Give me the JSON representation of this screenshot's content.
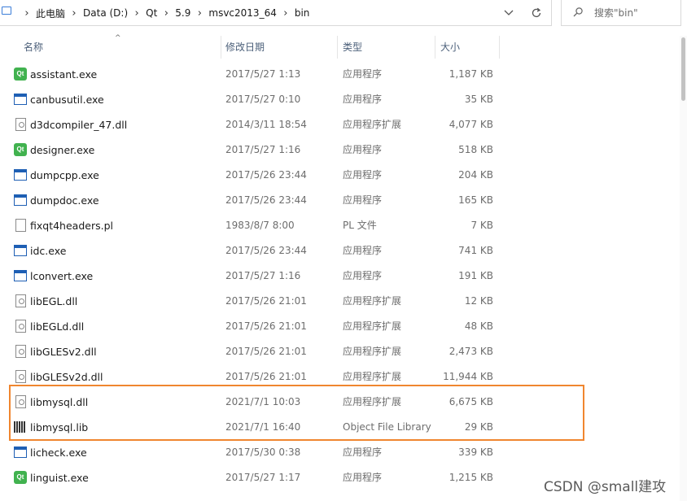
{
  "address_bar": {
    "crumbs": [
      "此电脑",
      "Data (D:)",
      "Qt",
      "5.9",
      "msvc2013_64",
      "bin"
    ],
    "separator": "›"
  },
  "search": {
    "placeholder": "搜索\"bin\""
  },
  "columns": {
    "name": "名称",
    "date": "修改日期",
    "type": "类型",
    "size": "大小"
  },
  "files": [
    {
      "name": "assistant.exe",
      "date": "2017/5/27 1:13",
      "type": "应用程序",
      "size": "1,187 KB",
      "icon": "qt-app-icon"
    },
    {
      "name": "canbusutil.exe",
      "date": "2017/5/27 0:10",
      "type": "应用程序",
      "size": "35 KB",
      "icon": "exe-icon"
    },
    {
      "name": "d3dcompiler_47.dll",
      "date": "2014/3/11 18:54",
      "type": "应用程序扩展",
      "size": "4,077 KB",
      "icon": "dll-icon"
    },
    {
      "name": "designer.exe",
      "date": "2017/5/27 1:16",
      "type": "应用程序",
      "size": "518 KB",
      "icon": "qt-app-icon"
    },
    {
      "name": "dumpcpp.exe",
      "date": "2017/5/26 23:44",
      "type": "应用程序",
      "size": "204 KB",
      "icon": "exe-icon"
    },
    {
      "name": "dumpdoc.exe",
      "date": "2017/5/26 23:44",
      "type": "应用程序",
      "size": "165 KB",
      "icon": "exe-icon"
    },
    {
      "name": "fixqt4headers.pl",
      "date": "1983/8/7 8:00",
      "type": "PL 文件",
      "size": "7 KB",
      "icon": "file-icon"
    },
    {
      "name": "idc.exe",
      "date": "2017/5/26 23:44",
      "type": "应用程序",
      "size": "741 KB",
      "icon": "exe-icon"
    },
    {
      "name": "lconvert.exe",
      "date": "2017/5/27 1:16",
      "type": "应用程序",
      "size": "191 KB",
      "icon": "exe-icon"
    },
    {
      "name": "libEGL.dll",
      "date": "2017/5/26 21:01",
      "type": "应用程序扩展",
      "size": "12 KB",
      "icon": "dll-icon"
    },
    {
      "name": "libEGLd.dll",
      "date": "2017/5/26 21:01",
      "type": "应用程序扩展",
      "size": "48 KB",
      "icon": "dll-icon"
    },
    {
      "name": "libGLESv2.dll",
      "date": "2017/5/26 21:01",
      "type": "应用程序扩展",
      "size": "2,473 KB",
      "icon": "dll-icon"
    },
    {
      "name": "libGLESv2d.dll",
      "date": "2017/5/26 21:01",
      "type": "应用程序扩展",
      "size": "11,944 KB",
      "icon": "dll-icon"
    },
    {
      "name": "libmysql.dll",
      "date": "2021/7/1 10:03",
      "type": "应用程序扩展",
      "size": "6,675 KB",
      "icon": "dll-icon"
    },
    {
      "name": "libmysql.lib",
      "date": "2021/7/1 16:40",
      "type": "Object File Library",
      "size": "29 KB",
      "icon": "lib-icon"
    },
    {
      "name": "licheck.exe",
      "date": "2017/5/30 0:38",
      "type": "应用程序",
      "size": "339 KB",
      "icon": "exe-icon"
    },
    {
      "name": "linguist.exe",
      "date": "2017/5/27 1:17",
      "type": "应用程序",
      "size": "1,215 KB",
      "icon": "qt-app-icon"
    }
  ],
  "icons": {
    "qt_label": "Qt"
  },
  "colors": {
    "highlight": "#f0862f",
    "header_text": "#4c607a",
    "qt_green": "#41b24f",
    "exe_blue": "#1e5fb4"
  },
  "watermark": "CSDN @small建攻"
}
